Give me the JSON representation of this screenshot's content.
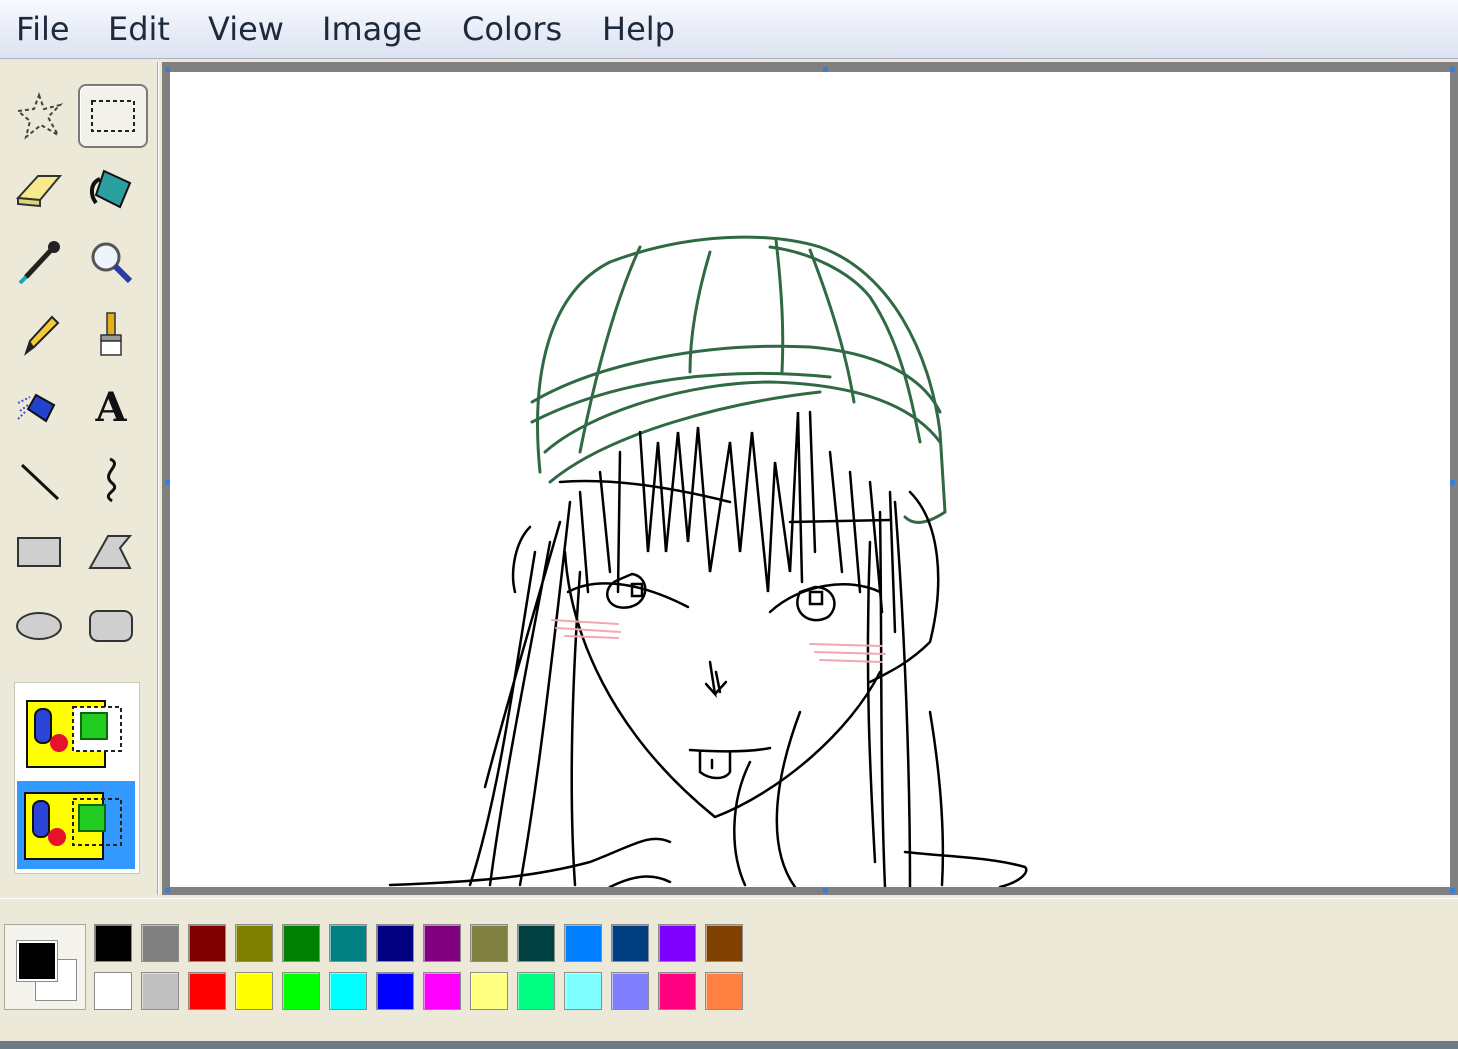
{
  "menu": {
    "items": [
      "File",
      "Edit",
      "View",
      "Image",
      "Colors",
      "Help"
    ]
  },
  "tools": [
    {
      "name": "free-form-select-icon",
      "selected": false
    },
    {
      "name": "rectangle-select-icon",
      "selected": true
    },
    {
      "name": "eraser-icon",
      "selected": false
    },
    {
      "name": "fill-bucket-icon",
      "selected": false
    },
    {
      "name": "color-picker-icon",
      "selected": false
    },
    {
      "name": "magnifier-icon",
      "selected": false
    },
    {
      "name": "pencil-icon",
      "selected": false
    },
    {
      "name": "brush-icon",
      "selected": false
    },
    {
      "name": "airbrush-icon",
      "selected": false
    },
    {
      "name": "text-icon",
      "selected": false
    },
    {
      "name": "line-icon",
      "selected": false
    },
    {
      "name": "curve-icon",
      "selected": false
    },
    {
      "name": "rectangle-icon",
      "selected": false
    },
    {
      "name": "polygon-icon",
      "selected": false
    },
    {
      "name": "ellipse-icon",
      "selected": false
    },
    {
      "name": "rounded-rectangle-icon",
      "selected": false
    }
  ],
  "selection_options": [
    {
      "name": "opaque-selection-option",
      "selected": false
    },
    {
      "name": "transparent-selection-option",
      "selected": true
    }
  ],
  "current_colors": {
    "foreground": "#000000",
    "background": "#ffffff"
  },
  "palette": {
    "row1": [
      "#000000",
      "#808080",
      "#800000",
      "#808000",
      "#008000",
      "#008080",
      "#000080",
      "#800080",
      "#808040",
      "#004040",
      "#0080ff",
      "#004080",
      "#8000ff",
      "#804000"
    ],
    "row2": [
      "#ffffff",
      "#c0c0c0",
      "#ff0000",
      "#ffff00",
      "#00ff00",
      "#00ffff",
      "#0000ff",
      "#ff00ff",
      "#ffff80",
      "#00ff80",
      "#80ffff",
      "#8080ff",
      "#ff0080",
      "#ff8040"
    ]
  },
  "drawing": {
    "ink_color": "#000000",
    "hat_color": "#2f6a44",
    "blush_color": "#f2a8b0"
  }
}
